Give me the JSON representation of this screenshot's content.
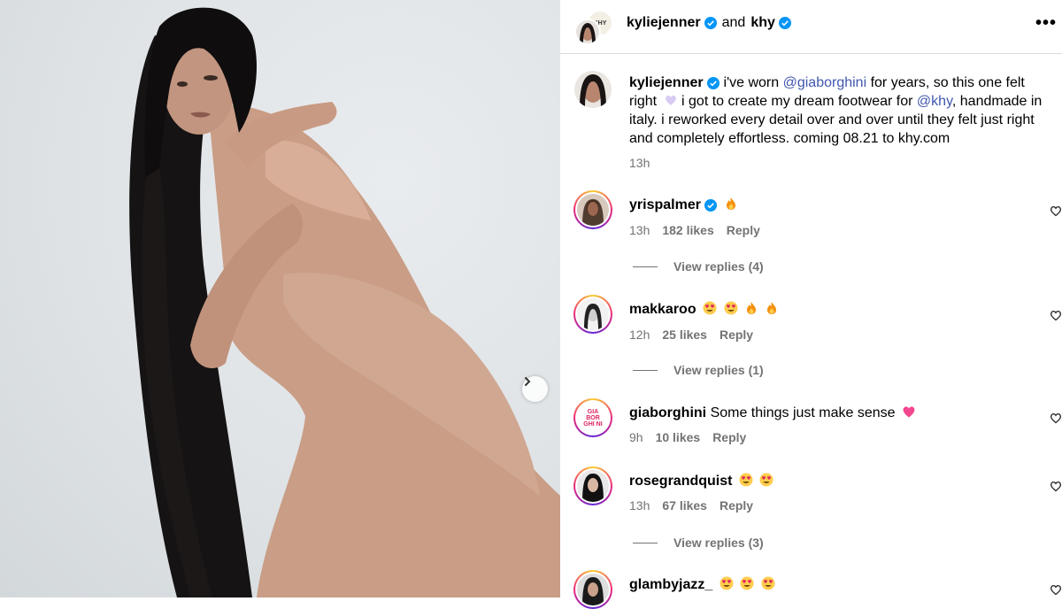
{
  "header": {
    "user1": "kyliejenner",
    "and_label": "and",
    "user2": "khy",
    "more_label": "•••",
    "khy_avatar_text": "KHY"
  },
  "caption": {
    "username": "kyliejenner",
    "t1": " i've worn ",
    "m1": "@giaborghini",
    "t2": " for years, so this one felt right ",
    "t3": "  i got to create my dream footwear for ",
    "m2": "@khy",
    "t4": ", handmade in italy. i reworked every detail over and over until they felt just right and completely effortless. coming 08.21 to khy.com",
    "time": "13h"
  },
  "comments": [
    {
      "username": "yrispalmer",
      "verified": true,
      "time": "13h",
      "likes": "182 likes",
      "reply": "Reply",
      "view_replies": "View replies (4)"
    },
    {
      "username": "makkaroo",
      "time": "12h",
      "likes": "25 likes",
      "reply": "Reply",
      "view_replies": "View replies (1)"
    },
    {
      "username": "giaborghini",
      "text": "Some things just make sense",
      "time": "9h",
      "likes": "10 likes",
      "reply": "Reply",
      "avatar_text": "GIA BOR GHI NI"
    },
    {
      "username": "rosegrandquist",
      "time": "13h",
      "likes": "67 likes",
      "reply": "Reply",
      "view_replies": "View replies (3)"
    },
    {
      "username": "glambyjazz_"
    }
  ],
  "icons": [
    "verified-icon",
    "more-icon",
    "heart-icon",
    "chevron-right-icon",
    "fire-emoji",
    "heart-eyes-emoji",
    "pink-heart-emoji"
  ],
  "colors": {
    "mention": "#4156b0",
    "verified": "#0095f6",
    "muted": "#737373"
  }
}
